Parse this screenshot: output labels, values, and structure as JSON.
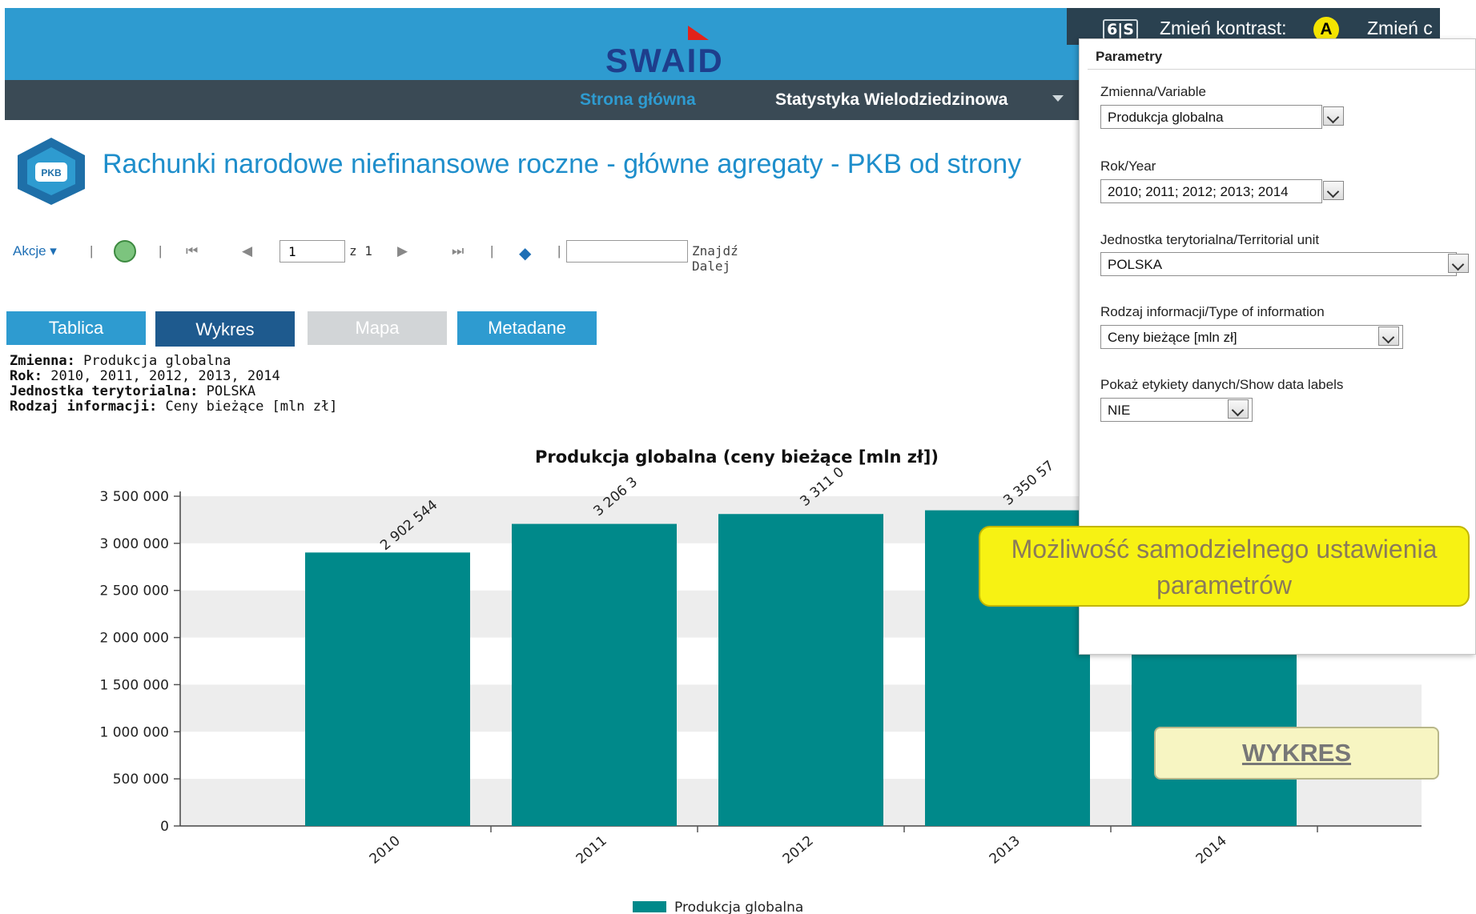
{
  "header": {
    "logo_text": "SWAID",
    "gis_label": "6|S",
    "contrast_label": "Zmień kontrast:",
    "contrast_button": "A",
    "contrast_more": "Zmień c"
  },
  "nav": {
    "home": "Strona główna",
    "statistics": "Statystyka Wielodziedzinowa"
  },
  "page": {
    "icon_label": "PKB",
    "title": "Rachunki narodowe niefinansowe roczne - główne agregaty - PKB od strony"
  },
  "toolbar": {
    "actions_label": "Akcje",
    "page_value": "1",
    "page_of": "z 1",
    "find_label": "Znajdź Dalej"
  },
  "tabs": [
    {
      "label": "Tablica"
    },
    {
      "label": "Wykres"
    },
    {
      "label": "Mapa"
    },
    {
      "label": "Metadane"
    }
  ],
  "info": {
    "variable_key": "Zmienna:",
    "variable_value": "Produkcja globalna",
    "year_key": "Rok:",
    "year_value": "2010, 2011, 2012, 2013, 2014",
    "unit_key": "Jednostka terytorialna:",
    "unit_value": "POLSKA",
    "type_key": "Rodzaj informacji:",
    "type_value": "Ceny bieżące [mln zł]"
  },
  "params": {
    "title": "Parametry",
    "variable_label": "Zmienna/Variable",
    "variable_value": "Produkcja globalna",
    "year_label": "Rok/Year",
    "year_value": "2010; 2011; 2012; 2013; 2014",
    "unit_label": "Jednostka terytorialna/Territorial unit",
    "unit_value": "POLSKA",
    "type_label": "Rodzaj informacji/Type of information",
    "type_value": "Ceny bieżące [mln zł]",
    "labels_label": "Pokaż etykiety danych/Show data labels",
    "labels_value": "NIE"
  },
  "callouts": {
    "params_note": "Możliwość samodzielnego ustawienia parametrów",
    "chart_note": "WYKRES"
  },
  "colors": {
    "bar": "#00898a",
    "accent": "#2e9bd0"
  },
  "chart_data": {
    "type": "bar",
    "title": "Produkcja globalna (ceny bieżące [mln zł])",
    "categories": [
      "2010",
      "2011",
      "2012",
      "2013",
      "2014"
    ],
    "series": [
      {
        "name": "Produkcja globalna",
        "values": [
          2902544,
          3206300,
          3311000,
          3350570,
          3350570
        ]
      }
    ],
    "data_labels": [
      "2 902 544",
      "3 206 3",
      "3 311 0",
      "3 350 57",
      ""
    ],
    "y_ticks": [
      "3 500 000",
      "3 000 000",
      "2 500 000",
      "2 000 000",
      "1 500 000",
      "1 000 000",
      "500 000",
      "0"
    ],
    "ylim": [
      0,
      3500000
    ],
    "legend": "bottom-center",
    "grid": true
  }
}
